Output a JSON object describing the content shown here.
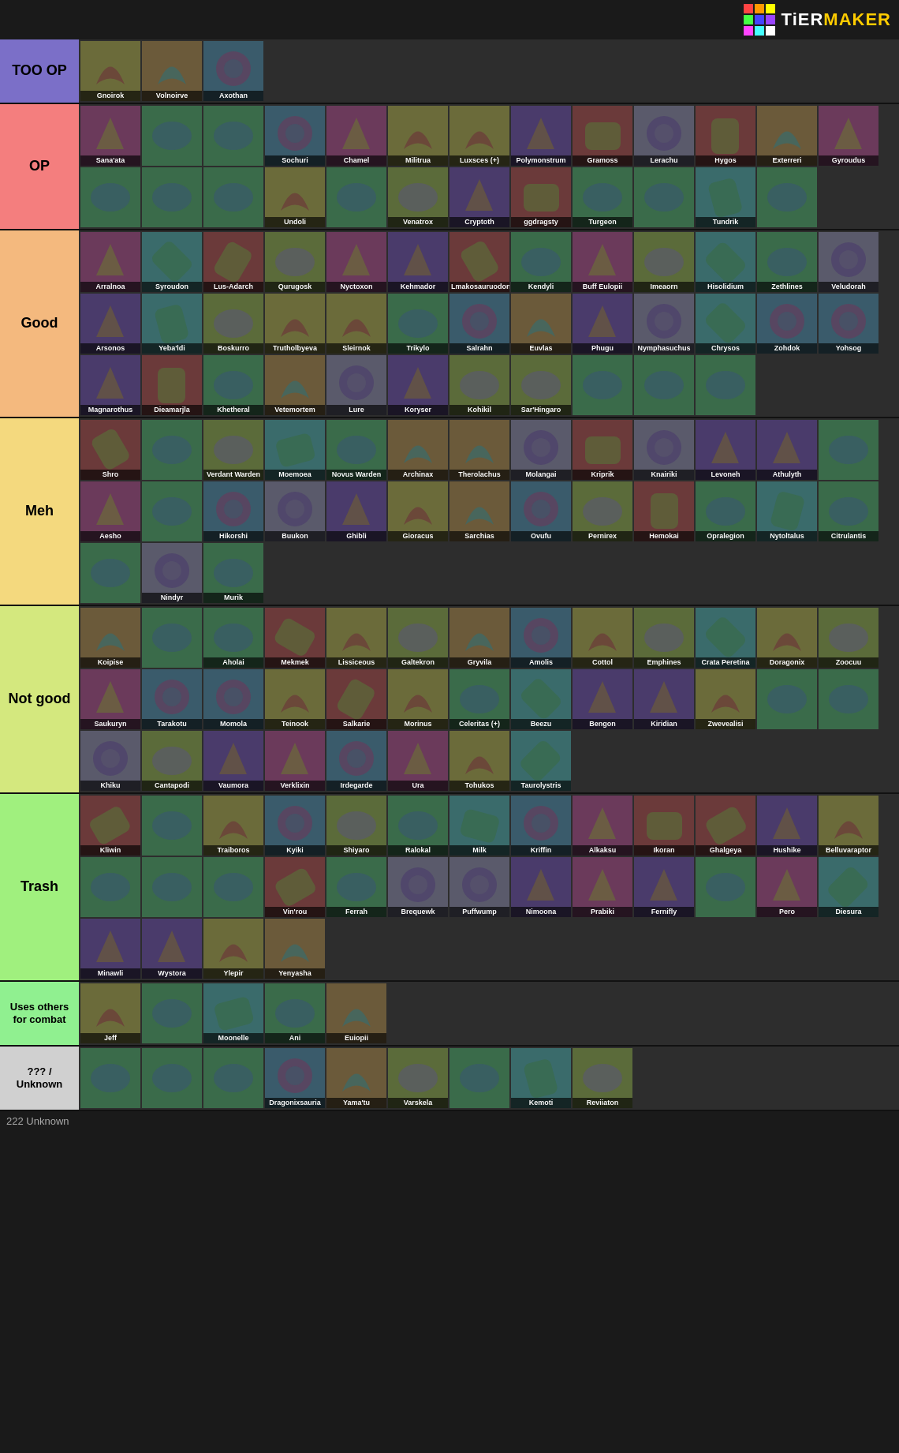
{
  "header": {
    "logo_text_tier": "TiER",
    "logo_text_maker": "MAKER",
    "logo_colors": [
      "#ff4444",
      "#ff9900",
      "#ffff00",
      "#44ff44",
      "#4444ff",
      "#9944ff",
      "#ff44ff",
      "#44ffff",
      "#ffffff"
    ]
  },
  "tiers": [
    {
      "id": "too-op",
      "label": "TOO OP",
      "label_class": "label-too-op",
      "items": [
        {
          "name": "Gnoirok",
          "class": "c4 shape-dragon"
        },
        {
          "name": "Volnoirve",
          "class": "c5 shape-dragon"
        },
        {
          "name": "Axothan",
          "class": "c6 shape-dragon"
        }
      ]
    },
    {
      "id": "op",
      "label": "OP",
      "label_class": "label-op",
      "items": [
        {
          "name": "Sana'ata",
          "class": "c1 shape-dragon"
        },
        {
          "name": "",
          "class": "c5 shape-dragon"
        },
        {
          "name": "",
          "class": "c6 shape-beast"
        },
        {
          "name": "Sochuri",
          "class": "c7 shape-creature"
        },
        {
          "name": "Chamel",
          "class": "c8 shape-dragon"
        },
        {
          "name": "Militrua",
          "class": "c9 shape-bird"
        },
        {
          "name": "Luxsces (+)",
          "class": "c10 shape-generic"
        },
        {
          "name": "Polymonstrum",
          "class": "c4 shape-generic"
        },
        {
          "name": "Gramoss",
          "class": "c11 shape-beast"
        },
        {
          "name": "Lerachu",
          "class": "c12 shape-creature"
        },
        {
          "name": "Hygos",
          "class": "c13 shape-dragon"
        },
        {
          "name": "Exterreri",
          "class": "c14 shape-beast"
        },
        {
          "name": "Gyroudus",
          "class": "c15 shape-dragon"
        },
        {
          "name": "",
          "class": "c1 shape-dragon"
        },
        {
          "name": "",
          "class": "c2 shape-dragon"
        },
        {
          "name": "",
          "class": "c3 shape-beast"
        },
        {
          "name": "Undoli",
          "class": "undoli shape-generic"
        },
        {
          "name": "",
          "class": "c5 shape-creature"
        },
        {
          "name": "Venatrox",
          "class": "c6 shape-dragon"
        },
        {
          "name": "Cryptoth",
          "class": "c7 shape-beast"
        },
        {
          "name": "ggdragsty",
          "class": "c8 shape-dragon"
        },
        {
          "name": "Turgeon",
          "class": "c9 shape-fish"
        },
        {
          "name": "",
          "class": "c10 shape-dragon"
        },
        {
          "name": "Tundrik",
          "class": "c11 shape-beast"
        },
        {
          "name": "",
          "class": "c12 shape-dragon"
        }
      ]
    },
    {
      "id": "good",
      "label": "Good",
      "label_class": "label-good",
      "items": [
        {
          "name": "Arralnoa",
          "class": "c1 shape-dragon"
        },
        {
          "name": "Syroudon",
          "class": "c2 shape-dragon"
        },
        {
          "name": "Lus-Adarch",
          "class": "c3 shape-beast"
        },
        {
          "name": "Qurugosk",
          "class": "c4 shape-dragon"
        },
        {
          "name": "Nyctoxon",
          "class": "c5 shape-dragon"
        },
        {
          "name": "Kehmador",
          "class": "c6 shape-beast"
        },
        {
          "name": "Lmakosauruodon",
          "class": "c7 shape-dragon"
        },
        {
          "name": "Kendyli",
          "class": "c8 shape-creature"
        },
        {
          "name": "Buff Eulopii",
          "class": "c9 shape-generic"
        },
        {
          "name": "Imeaorn",
          "class": "c10 shape-dragon"
        },
        {
          "name": "Hisolidium",
          "class": "c11 shape-beast"
        },
        {
          "name": "Zethlines",
          "class": "c12 shape-dragon"
        },
        {
          "name": "Veludorah",
          "class": "c13 shape-dragon"
        },
        {
          "name": "Arsonos",
          "class": "c14 shape-beast"
        },
        {
          "name": "Yeba'ldi",
          "class": "c15 shape-creature"
        },
        {
          "name": "Boskurro",
          "class": "c16 shape-dragon"
        },
        {
          "name": "Trutholbyeva",
          "class": "c17 shape-beast"
        },
        {
          "name": "Sleirnok",
          "class": "c18 shape-dragon"
        },
        {
          "name": "Trikylo",
          "class": "c19 shape-creature"
        },
        {
          "name": "Salrahn",
          "class": "salrahn shape-generic"
        },
        {
          "name": "Euvlas",
          "class": "c1 shape-dragon"
        },
        {
          "name": "Phugu",
          "class": "c2 shape-beast"
        },
        {
          "name": "Nymphasuchus",
          "class": "c3 shape-dragon"
        },
        {
          "name": "Chrysos",
          "class": "c4 shape-beast"
        },
        {
          "name": "Zohdok",
          "class": "c5 shape-dragon"
        },
        {
          "name": "Yohsog",
          "class": "c6 shape-creature"
        },
        {
          "name": "Magnarothus",
          "class": "c7 shape-dragon"
        },
        {
          "name": "Dieamarjla",
          "class": "c8 shape-beast"
        },
        {
          "name": "Khetheral",
          "class": "c9 shape-dragon"
        },
        {
          "name": "Vetemortem",
          "class": "c10 shape-creature"
        },
        {
          "name": "Lure",
          "class": "c11 shape-fish"
        },
        {
          "name": "Koryser",
          "class": "c12 shape-dragon"
        },
        {
          "name": "Kohikil",
          "class": "c13 shape-beast"
        },
        {
          "name": "Sar'Hingaro",
          "class": "c14 shape-dragon"
        },
        {
          "name": "",
          "class": "c15 shape-dragon"
        },
        {
          "name": "",
          "class": "c16 shape-beast"
        },
        {
          "name": "",
          "class": "c17 shape-dragon"
        }
      ]
    },
    {
      "id": "meh",
      "label": "Meh",
      "label_class": "label-meh",
      "items": [
        {
          "name": "Shro",
          "class": "c1 shape-dragon"
        },
        {
          "name": "",
          "class": "c2 shape-beast"
        },
        {
          "name": "Verdant Warden",
          "class": "c3 shape-dragon"
        },
        {
          "name": "Moemoea",
          "class": "c4 shape-creature"
        },
        {
          "name": "Novus Warden",
          "class": "c5 shape-beast"
        },
        {
          "name": "Archinax",
          "class": "c6 shape-dragon"
        },
        {
          "name": "Therolachus",
          "class": "c7 shape-beast"
        },
        {
          "name": "Molangai",
          "class": "c8 shape-dragon"
        },
        {
          "name": "Kriprik",
          "class": "c9 shape-creature"
        },
        {
          "name": "Knairiki",
          "class": "c10 shape-beast"
        },
        {
          "name": "Levoneh",
          "class": "c11 shape-dragon"
        },
        {
          "name": "Athulyth",
          "class": "c12 shape-dragon"
        },
        {
          "name": "",
          "class": "c13 shape-beast"
        },
        {
          "name": "Aesho",
          "class": "c14 shape-dragon"
        },
        {
          "name": "",
          "class": "c15 shape-creature"
        },
        {
          "name": "Hikorshi",
          "class": "c16 shape-beast"
        },
        {
          "name": "Buukon",
          "class": "c17 shape-dragon"
        },
        {
          "name": "Ghibli",
          "class": "c18 shape-creature"
        },
        {
          "name": "Gioracus",
          "class": "c19 shape-dragon"
        },
        {
          "name": "Sarchias",
          "class": "c20 shape-beast"
        },
        {
          "name": "Ovufu",
          "class": "c1 shape-creature"
        },
        {
          "name": "Pernirex",
          "class": "c2 shape-dragon"
        },
        {
          "name": "Hemokai",
          "class": "c3 shape-beast"
        },
        {
          "name": "Opralegion",
          "class": "c4 shape-dragon"
        },
        {
          "name": "Nytoltalus",
          "class": "c5 shape-creature"
        },
        {
          "name": "Citrulantis",
          "class": "c6 shape-beast"
        },
        {
          "name": "",
          "class": "c7 shape-dragon"
        },
        {
          "name": "Nindyr",
          "class": "c8 shape-beast"
        },
        {
          "name": "Murik",
          "class": "c9 shape-dragon"
        }
      ]
    },
    {
      "id": "not-good",
      "label": "Not good",
      "label_class": "label-not-good",
      "items": [
        {
          "name": "Koipise",
          "class": "c1 shape-creature"
        },
        {
          "name": "",
          "class": "c2 shape-dragon"
        },
        {
          "name": "Aholai",
          "class": "c3 shape-beast"
        },
        {
          "name": "Mekmek",
          "class": "c4 shape-creature"
        },
        {
          "name": "Lissiceous",
          "class": "c5 shape-dragon"
        },
        {
          "name": "Galtekron",
          "class": "c6 shape-beast"
        },
        {
          "name": "Gryvila",
          "class": "c7 shape-dragon"
        },
        {
          "name": "Amolis",
          "class": "c8 shape-creature"
        },
        {
          "name": "Cottol",
          "class": "c9 shape-dragon"
        },
        {
          "name": "Emphines",
          "class": "c10 shape-beast"
        },
        {
          "name": "Crata Peretina",
          "class": "c11 shape-dragon"
        },
        {
          "name": "Doragonix",
          "class": "c12 shape-beast"
        },
        {
          "name": "Zoocuu",
          "class": "c13 shape-dragon"
        },
        {
          "name": "Saukuryn",
          "class": "c14 shape-creature"
        },
        {
          "name": "Tarakotu",
          "class": "c15 shape-beast"
        },
        {
          "name": "Momola",
          "class": "c16 shape-dragon"
        },
        {
          "name": "Teinook",
          "class": "c17 shape-creature"
        },
        {
          "name": "Salkarie",
          "class": "c18 shape-dragon"
        },
        {
          "name": "Morinus",
          "class": "c19 shape-beast"
        },
        {
          "name": "Celeritas (+)",
          "class": "celeritas shape-generic"
        },
        {
          "name": "Beezu",
          "class": "c1 shape-creature"
        },
        {
          "name": "Bengon",
          "class": "c2 shape-dragon"
        },
        {
          "name": "Kiridian",
          "class": "c3 shape-beast"
        },
        {
          "name": "Zwevealisi",
          "class": "c4 shape-dragon"
        },
        {
          "name": "",
          "class": "c5 shape-creature"
        },
        {
          "name": "",
          "class": "c6 shape-dragon"
        },
        {
          "name": "Khiku",
          "class": "c7 shape-beast"
        },
        {
          "name": "Cantapodi",
          "class": "c8 shape-dragon"
        },
        {
          "name": "Vaumora",
          "class": "c9 shape-creature"
        },
        {
          "name": "Verklixin",
          "class": "c10 shape-dragon"
        },
        {
          "name": "Irdegarde",
          "class": "c11 shape-beast"
        },
        {
          "name": "Ura",
          "class": "c12 shape-dragon"
        },
        {
          "name": "Tohukos",
          "class": "c13 shape-creature"
        },
        {
          "name": "Taurolystris",
          "class": "c14 shape-beast"
        }
      ]
    },
    {
      "id": "trash",
      "label": "Trash",
      "label_class": "label-trash",
      "items": [
        {
          "name": "Kliwin",
          "class": "c1 shape-creature"
        },
        {
          "name": "",
          "class": "c2 shape-dragon"
        },
        {
          "name": "Traiboros",
          "class": "c3 shape-beast"
        },
        {
          "name": "Kyiki",
          "class": "c4 shape-dragon"
        },
        {
          "name": "Shiyaro",
          "class": "c5 shape-creature"
        },
        {
          "name": "Ralokal",
          "class": "c6 shape-dragon"
        },
        {
          "name": "Milk",
          "class": "c7 shape-beast"
        },
        {
          "name": "Kriffin",
          "class": "c8 shape-dragon"
        },
        {
          "name": "Alkaksu",
          "class": "c9 shape-creature"
        },
        {
          "name": "Ikoran",
          "class": "c10 shape-beast"
        },
        {
          "name": "Ghalgeya",
          "class": "c11 shape-dragon"
        },
        {
          "name": "Hushike",
          "class": "c12 shape-creature"
        },
        {
          "name": "Belluvaraptor",
          "class": "c13 shape-beast"
        },
        {
          "name": "",
          "class": "c14 shape-dragon"
        },
        {
          "name": "",
          "class": "c15 shape-creature"
        },
        {
          "name": "",
          "class": "c16 shape-beast"
        },
        {
          "name": "Vin'rou",
          "class": "c17 shape-dragon"
        },
        {
          "name": "Ferrah",
          "class": "c18 shape-creature"
        },
        {
          "name": "Brequewk",
          "class": "c19 shape-beast"
        },
        {
          "name": "Puffwump",
          "class": "c20 shape-dragon"
        },
        {
          "name": "Nimoona",
          "class": "c1 shape-creature"
        },
        {
          "name": "Prabiki",
          "class": "c2 shape-beast"
        },
        {
          "name": "Fernifly",
          "class": "c3 shape-dragon"
        },
        {
          "name": "",
          "class": "c4 shape-creature"
        },
        {
          "name": "Pero",
          "class": "c5 shape-beast"
        },
        {
          "name": "Diesura",
          "class": "c6 shape-dragon"
        },
        {
          "name": "Minawli",
          "class": "c7 shape-creature"
        },
        {
          "name": "Wystora",
          "class": "c8 shape-beast"
        },
        {
          "name": "Ylepir",
          "class": "c9 shape-dragon"
        },
        {
          "name": "Yenyasha",
          "class": "c10 shape-creature"
        }
      ]
    },
    {
      "id": "uses-others",
      "label": "Uses others for combat",
      "label_class": "label-uses-others",
      "items": [
        {
          "name": "Jeff",
          "class": "c3 shape-generic"
        },
        {
          "name": "",
          "class": "c16 shape-bird"
        },
        {
          "name": "Moonelle",
          "class": "c5 shape-creature"
        },
        {
          "name": "Ani",
          "class": "c6 shape-dragon"
        },
        {
          "name": "Euiopii",
          "class": "c7 shape-beast"
        }
      ]
    },
    {
      "id": "unknown",
      "label": "??? / Unknown",
      "label_class": "label-unknown",
      "items": [
        {
          "name": "",
          "class": "c5 shape-dragon"
        },
        {
          "name": "",
          "class": "c4 shape-beast"
        },
        {
          "name": "",
          "class": "c12 shape-creature"
        },
        {
          "name": "Dragonixsauria",
          "class": "c7 shape-dragon"
        },
        {
          "name": "Yama'tu",
          "class": "c8 shape-beast"
        },
        {
          "name": "Varskela",
          "class": "c9 shape-dragon"
        },
        {
          "name": "",
          "class": "c10 shape-creature"
        },
        {
          "name": "Kemoti",
          "class": "c11 shape-beast"
        },
        {
          "name": "Reviiaton",
          "class": "c13 shape-dragon"
        }
      ]
    }
  ]
}
